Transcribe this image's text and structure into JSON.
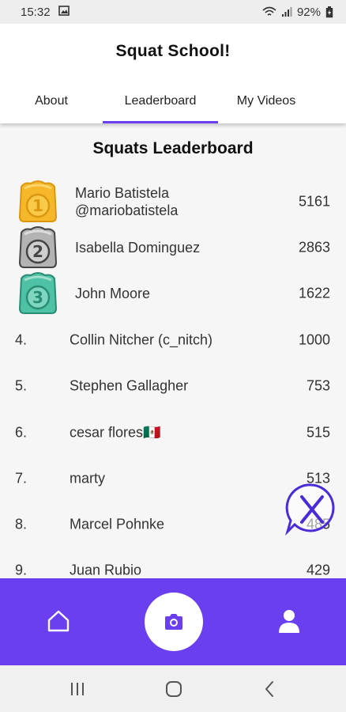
{
  "status_bar": {
    "time": "15:32",
    "battery": "92%"
  },
  "header": {
    "title": "Squat School!"
  },
  "tabs": [
    {
      "label": "About",
      "active": false
    },
    {
      "label": "Leaderboard",
      "active": true
    },
    {
      "label": "My Videos",
      "active": false
    }
  ],
  "leaderboard": {
    "title": "Squats Leaderboard",
    "medal_rows": [
      {
        "rank": "1",
        "name": "Mario Batistela",
        "handle": "@mariobatistela",
        "score": "5161"
      },
      {
        "rank": "2",
        "name": "Isabella Dominguez",
        "score": "2863"
      },
      {
        "rank": "3",
        "name": "John Moore",
        "score": "1622"
      }
    ],
    "rows": [
      {
        "rank": "4.",
        "name": "Collin Nitcher (c_nitch)",
        "score": "1000"
      },
      {
        "rank": "5.",
        "name": "Stephen Gallagher",
        "score": "753"
      },
      {
        "rank": "6.",
        "name": "cesar flores🇲🇽",
        "score": "515"
      },
      {
        "rank": "7.",
        "name": "marty",
        "score": "513"
      },
      {
        "rank": "8.",
        "name": "Marcel Pohnke",
        "score": "485"
      },
      {
        "rank": "9.",
        "name": "Juan Rubio",
        "score": "429"
      }
    ]
  },
  "colors": {
    "accent": "#6a3ff0",
    "gold": "#f5b82a",
    "silver": "#a7a7a7",
    "bronze": "#4fc1a4"
  },
  "icons": {
    "home": "home-icon",
    "camera": "camera-icon",
    "profile": "profile-icon",
    "fab": "x-chat-icon"
  }
}
